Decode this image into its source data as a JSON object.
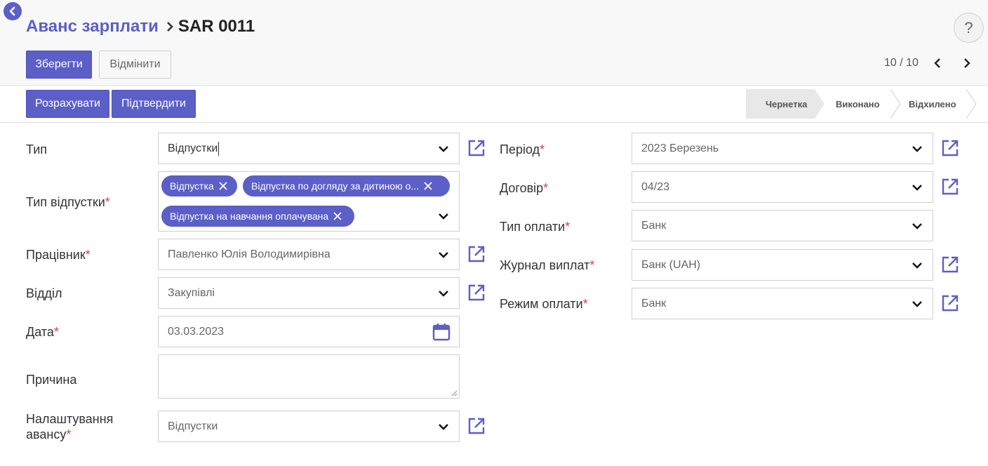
{
  "breadcrumb": {
    "parent": "Аванс зарплати",
    "current": "SAR 0011"
  },
  "help": {
    "label": "?"
  },
  "toolbar": {
    "save_label": "Зберегти",
    "discard_label": "Відмінити"
  },
  "pager": {
    "value": "10 / 10"
  },
  "actions": {
    "compute_label": "Розрахувати",
    "confirm_label": "Підтвердити"
  },
  "status": {
    "steps": [
      "Чернетка",
      "Виконано",
      "Відхилено"
    ],
    "active": "Чернетка"
  },
  "form": {
    "type": {
      "label": "Тип",
      "value": "Відпустки"
    },
    "leave_type": {
      "label": "Тип відпустки",
      "tags": [
        "Відпустка",
        "Відпустка по догляду за дитиною о...",
        "Відпустка на навчання оплачувана"
      ]
    },
    "employee": {
      "label": "Працівник",
      "value": "Павленко Юлія Володимирівна"
    },
    "department": {
      "label": "Відділ",
      "value": "Закупівлі"
    },
    "date": {
      "label": "Дата",
      "value": "03.03.2023"
    },
    "reason": {
      "label": "Причина",
      "value": ""
    },
    "advance_settings": {
      "label_line1": "Налаштування",
      "label_line2": "авансу",
      "value": "Відпустки"
    },
    "period": {
      "label": "Період",
      "value": "2023 Березень"
    },
    "contract": {
      "label": "Договір",
      "value": "04/23"
    },
    "payment_type": {
      "label": "Тип оплати",
      "value": "Банк"
    },
    "payment_journal": {
      "label": "Журнал виплат",
      "value": "Банк (UAH)"
    },
    "payment_mode": {
      "label": "Режим оплати",
      "value": "Банк"
    }
  },
  "colors": {
    "accent": "#5b5fc7",
    "required": "#d04545"
  }
}
